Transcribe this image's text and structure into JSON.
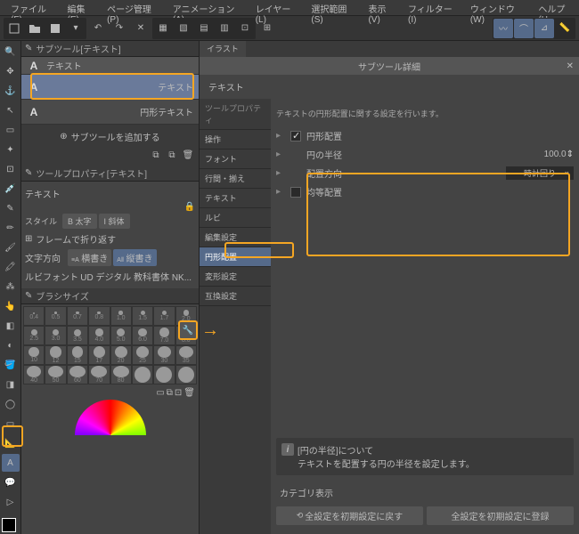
{
  "menu": {
    "file": "ファイル(F)",
    "edit": "編集(E)",
    "page": "ページ管理(P)",
    "anim": "アニメーション(A)",
    "layer": "レイヤー(L)",
    "select": "選択範囲(S)",
    "view": "表示(V)",
    "filter": "フィルター(I)",
    "window": "ウィンドウ(W)",
    "help": "ヘルプ(H"
  },
  "subtool_panel": {
    "title": "サブツール[テキスト]",
    "header": "テキスト",
    "items": [
      {
        "icon": "A",
        "label": "テキスト"
      },
      {
        "icon": "A",
        "label": "円形テキスト"
      }
    ],
    "add": "サブツールを追加する"
  },
  "toolprop": {
    "title": "ツールプロパティ[テキスト]",
    "name": "テキスト",
    "style_label": "スタイル",
    "bold": "B 太字",
    "italic": "I 斜体",
    "wrap": "フレームで折り返す",
    "dir_label": "文字方向",
    "yoko": "横書き",
    "tate": "縦書き",
    "ruby": "ルビフォント",
    "ruby_font": "UD デジタル 教科書体 NK..."
  },
  "brush": {
    "title": "ブラシサイズ",
    "sizes": [
      "0.4",
      "0.5",
      "0.7",
      "0.8",
      "1.0",
      "1.5",
      "1.7",
      "2.0",
      "2.5",
      "3.0",
      "3.5",
      "4.0",
      "5.0",
      "6.0",
      "7.0",
      "8.0",
      "10",
      "12",
      "15",
      "17",
      "20",
      "25",
      "30",
      "35",
      "40",
      "50",
      "60",
      "70",
      "80",
      "",
      "",
      ""
    ]
  },
  "tab": "イラスト",
  "detail": {
    "title": "サブツール詳細",
    "name": "テキスト",
    "cat_label": "ツールプロパティ",
    "categories": [
      "操作",
      "フォント",
      "行間・揃え",
      "テキスト",
      "ルビ",
      "編集設定",
      "円形配置",
      "変形設定",
      "互換設定"
    ],
    "desc": "テキストの円形配置に関する設定を行います。",
    "settings": {
      "enkei": "円形配置",
      "radius_label": "円の半径",
      "radius_value": "100.0",
      "dir_label": "配置方向",
      "dir_value": "時計回り",
      "even": "均等配置"
    },
    "info_title": "[円の半径]について",
    "info_body": "テキストを配置する円の半径を設定します。",
    "cat_show": "カテゴリ表示",
    "reset": "全設定を初期設定に戻す",
    "register": "全設定を初期設定に登録"
  }
}
